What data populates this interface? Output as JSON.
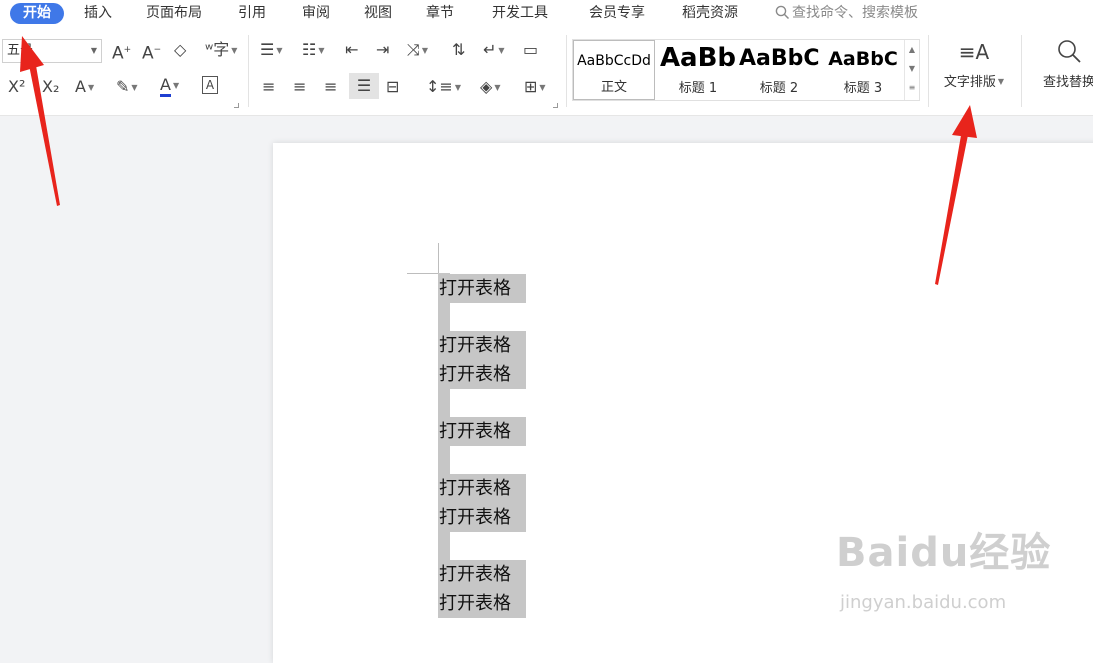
{
  "tabs": [
    {
      "label": "开始",
      "active": true
    },
    {
      "label": "插入"
    },
    {
      "label": "页面布局"
    },
    {
      "label": "引用"
    },
    {
      "label": "审阅"
    },
    {
      "label": "视图"
    },
    {
      "label": "章节"
    },
    {
      "label": "开发工具"
    },
    {
      "label": "会员专享"
    },
    {
      "label": "稻壳资源"
    }
  ],
  "search": {
    "placeholder": "查找命令、搜索模板",
    "icon": "search-icon"
  },
  "ribbon": {
    "font_size_value": "五号",
    "styles": [
      {
        "sample": "AaBbCcDd",
        "name": "正文"
      },
      {
        "sample": "AaBb",
        "name": "标题 1"
      },
      {
        "sample": "AaBbC",
        "name": "标题 2"
      },
      {
        "sample": "AaBbC",
        "name": "标题 3"
      }
    ],
    "text_layout_label": "文字排版",
    "find_replace_label": "查找替换"
  },
  "document": {
    "lines": [
      "打开表格",
      "",
      "打开表格",
      "打开表格",
      "",
      "打开表格",
      "",
      "打开表格",
      "打开表格",
      "",
      "打开表格",
      "打开表格"
    ]
  },
  "watermark": {
    "brand": "Baidu经验",
    "url": "jingyan.baidu.com"
  },
  "colors": {
    "accent": "#3f78e8",
    "annotation_arrow": "#e8241c",
    "selection": "#c6c6c6"
  }
}
